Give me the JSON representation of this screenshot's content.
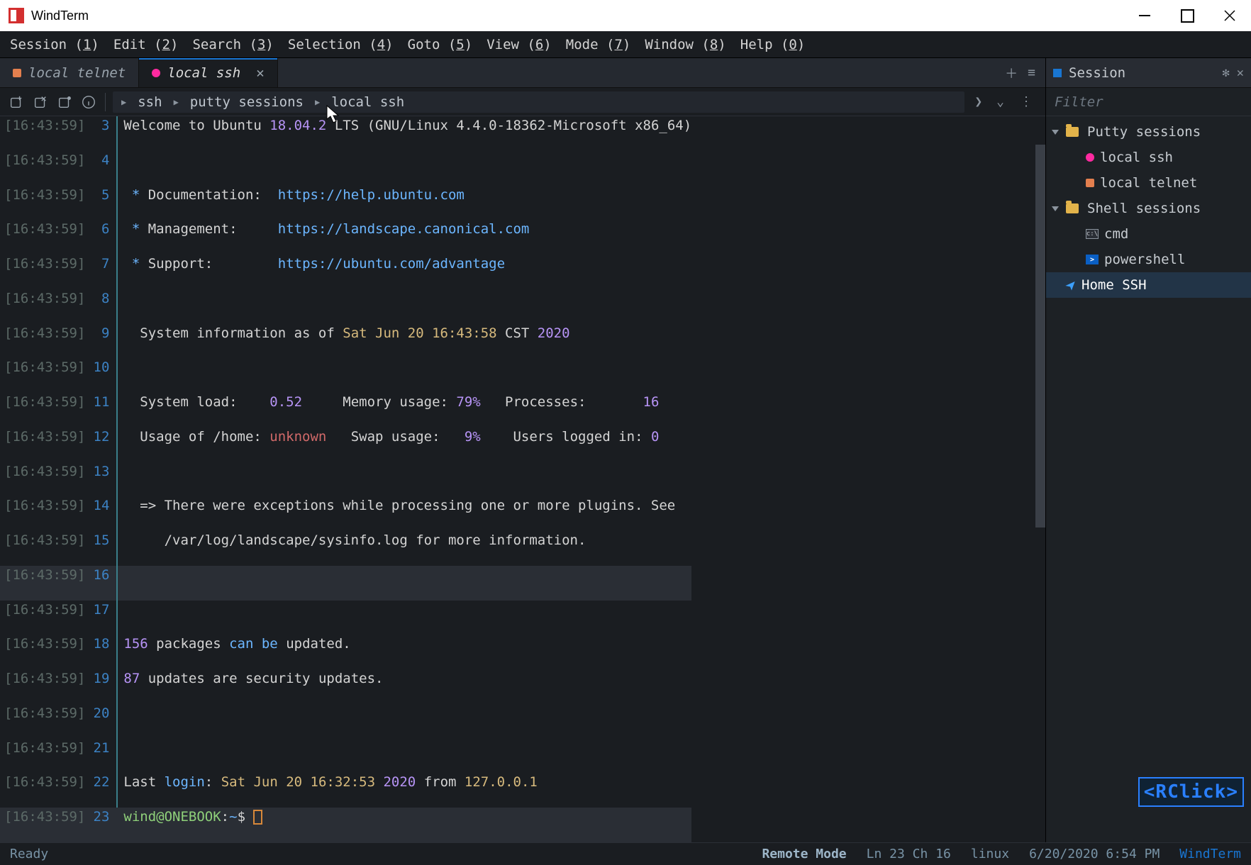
{
  "app": {
    "title": "WindTerm"
  },
  "menu": [
    {
      "label": "Session",
      "accel": "1"
    },
    {
      "label": "Edit",
      "accel": "2"
    },
    {
      "label": "Search",
      "accel": "3"
    },
    {
      "label": "Selection",
      "accel": "4"
    },
    {
      "label": "Goto",
      "accel": "5"
    },
    {
      "label": "View",
      "accel": "6"
    },
    {
      "label": "Mode",
      "accel": "7"
    },
    {
      "label": "Window",
      "accel": "8"
    },
    {
      "label": "Help",
      "accel": "0"
    }
  ],
  "tabs": [
    {
      "label": "local telnet",
      "color": "#e37f4e",
      "shape": "sq",
      "active": false
    },
    {
      "label": "local ssh",
      "color": "#ff2aa0",
      "shape": "circle",
      "active": true
    }
  ],
  "breadcrumb": [
    "ssh",
    "putty sessions",
    "local ssh"
  ],
  "panel": {
    "title": "Session",
    "filter_placeholder": "Filter",
    "tree": {
      "putty_label": "Putty sessions",
      "putty_children": [
        {
          "label": "local ssh",
          "color": "#ff2aa0"
        },
        {
          "label": "local telnet",
          "color": "#e37f4e"
        }
      ],
      "shell_label": "Shell sessions",
      "shell_children": [
        {
          "label": "cmd"
        },
        {
          "label": "powershell"
        }
      ],
      "home_label": "Home SSH"
    }
  },
  "hint": "<RClick>",
  "status": {
    "left": "Ready",
    "mode": "Remote Mode",
    "pos": "Ln 23 Ch 16",
    "os": "linux",
    "time": "6/20/2020 6:54 PM",
    "brand": "WindTerm"
  },
  "timestamp": "[16:43:59]",
  "terminal": {
    "welcome_a": "Welcome to Ubuntu ",
    "welcome_ver": "18.04.2",
    "welcome_b": " LTS ",
    "welcome_c": "(GNU/Linux 4.4.0-18362-Microsoft x86_64)",
    "doc_label": " * Documentation:  ",
    "doc_url": "https://help.ubuntu.com",
    "mgmt_label": " * Management:     ",
    "mgmt_url": "https://landscape.canonical.com",
    "sup_label": " * Support:        ",
    "sup_url": "https://ubuntu.com/advantage",
    "sysinfo_a": "  System information as of ",
    "sysinfo_date": "Sat Jun 20 16:43:58",
    "sysinfo_tz": " CST ",
    "sysinfo_year": "2020",
    "row1_a": "  System load:    ",
    "row1_v1": "0.52",
    "row1_b": "     Memory usage: ",
    "row1_v2": "79%",
    "row1_c": "   Processes:       ",
    "row1_v3": "16",
    "row2_a": "  Usage of /home: ",
    "row2_v1": "unknown",
    "row2_b": "   Swap usage:   ",
    "row2_v2": "9%",
    "row2_c": "    Users logged in: ",
    "row2_v3": "0",
    "exc1": "  => There were exceptions while processing one or more plugins. See",
    "exc2": "     /var/log/landscape/sysinfo.log for more information.",
    "pkg_n": "156",
    "pkg_a": " packages ",
    "pkg_can": "can be",
    "pkg_b": " updated.",
    "sec_n": "87",
    "sec_a": " updates are security updates.",
    "last_a": "Last ",
    "last_login": "login",
    "last_b": ": ",
    "last_date": "Sat Jun 20 16:32:53",
    "last_sp": " ",
    "last_year": "2020",
    "last_c": " from ",
    "last_ip": "127.0.0.1",
    "prompt_user": "wind@ONEBOOK",
    "prompt_colon": ":",
    "prompt_path": "~",
    "prompt_dollar": "$ "
  }
}
